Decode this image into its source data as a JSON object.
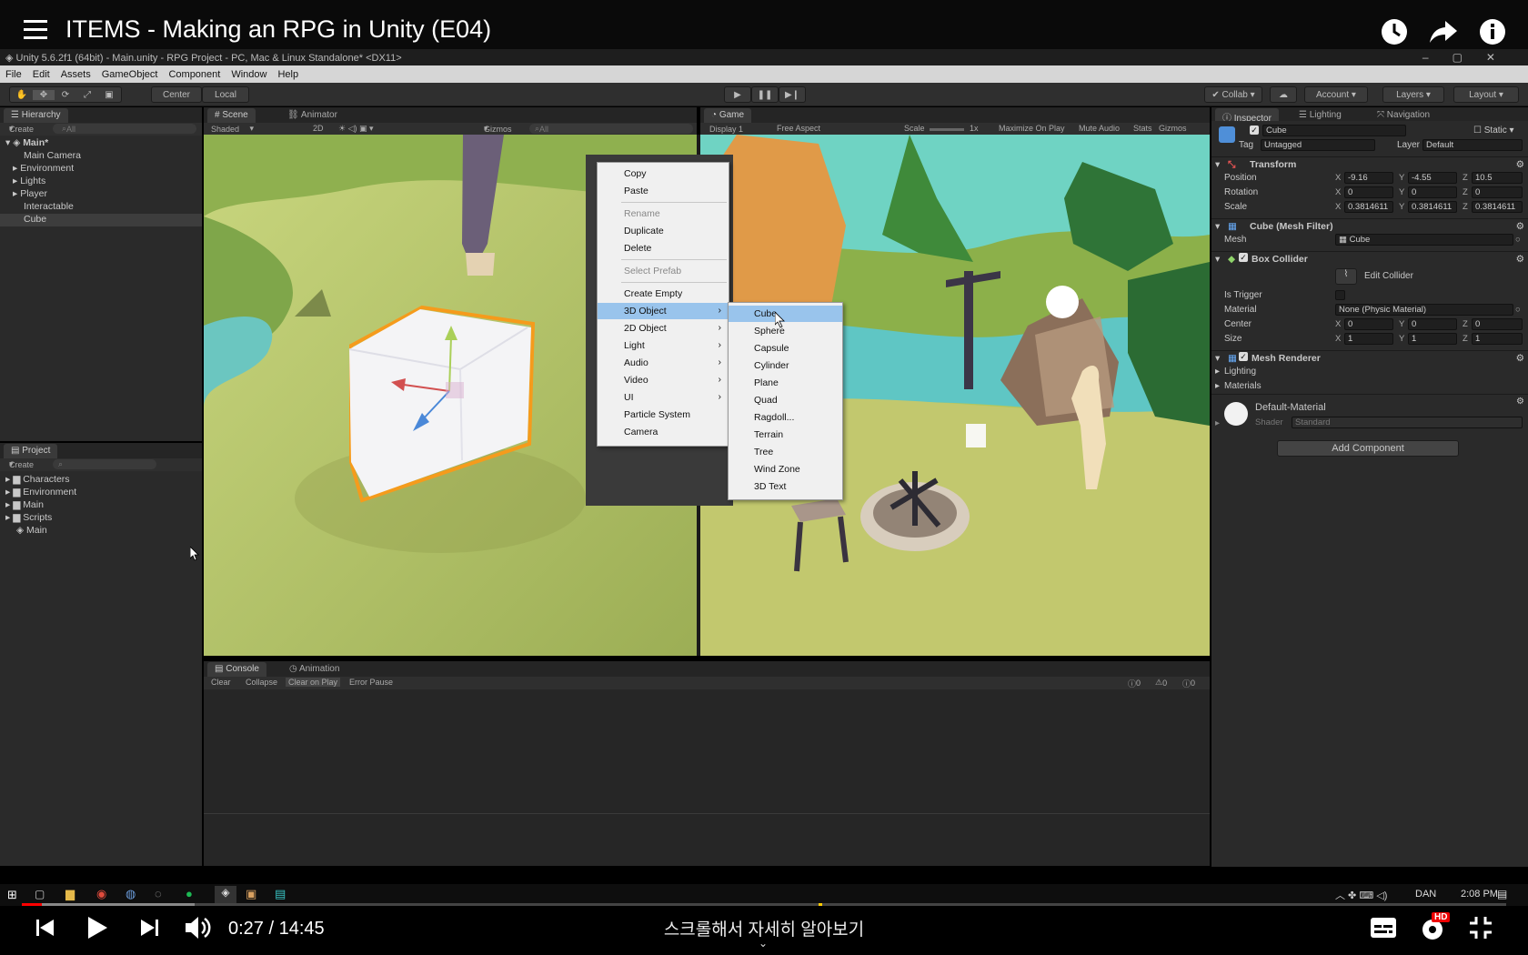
{
  "youtube": {
    "title": "ITEMS - Making an RPG in Unity (E04)",
    "time_current": "0:27",
    "time_separator": "/",
    "time_total": "14:45",
    "hint": "스크롤해서 자세히 알아보기",
    "progress_fraction": 0.0305,
    "hd_badge": "HD",
    "accent_color": "#ff0000"
  },
  "unity": {
    "window_title": "Unity 5.6.2f1 (64bit) - Main.unity - RPG Project - PC, Mac & Linux Standalone* <DX11>",
    "menu": [
      "File",
      "Edit",
      "Assets",
      "GameObject",
      "Component",
      "Window",
      "Help"
    ],
    "toolbar": {
      "center": "Center",
      "local": "Local",
      "collab": "Collab",
      "account": "Account",
      "layers": "Layers",
      "layout": "Layout"
    }
  },
  "hierarchy": {
    "tab": "Hierarchy",
    "create": "Create",
    "search": "All",
    "scene": "Main*",
    "items": [
      "Main Camera",
      "Environment",
      "Lights",
      "Player",
      "Interactable",
      "Cube"
    ]
  },
  "project": {
    "tab": "Project",
    "create": "Create",
    "items": [
      "Characters",
      "Environment",
      "Main",
      "Scripts",
      "Main"
    ]
  },
  "scene": {
    "tab": "Scene",
    "tab2": "Animator",
    "shaded": "Shaded",
    "mode2d": "2D",
    "gizmos": "Gizmos",
    "search": "All"
  },
  "game": {
    "tab": "Game",
    "display": "Display 1",
    "aspect": "Free Aspect",
    "scale_label": "Scale",
    "scale_value": "1x",
    "maximize": "Maximize On Play",
    "mute": "Mute Audio",
    "stats": "Stats",
    "gizmos": "Gizmos"
  },
  "context_menu": {
    "items": [
      {
        "label": "Copy"
      },
      {
        "label": "Paste"
      },
      {
        "label": "Rename",
        "disabled": true
      },
      {
        "label": "Duplicate"
      },
      {
        "label": "Delete"
      },
      {
        "label": "Select Prefab",
        "disabled": true
      },
      {
        "label": "Create Empty"
      },
      {
        "label": "3D Object",
        "submenu": true,
        "highlighted": true
      },
      {
        "label": "2D Object",
        "submenu": true
      },
      {
        "label": "Light",
        "submenu": true
      },
      {
        "label": "Audio",
        "submenu": true
      },
      {
        "label": "Video",
        "submenu": true
      },
      {
        "label": "UI",
        "submenu": true
      },
      {
        "label": "Particle System"
      },
      {
        "label": "Camera"
      }
    ],
    "submenu": [
      "Cube",
      "Sphere",
      "Capsule",
      "Cylinder",
      "Plane",
      "Quad",
      "Ragdoll...",
      "Terrain",
      "Tree",
      "Wind Zone",
      "3D Text"
    ],
    "submenu_highlight_color": "#99c4ec"
  },
  "inspector": {
    "tabs": [
      "Inspector",
      "Lighting",
      "Navigation"
    ],
    "object_name": "Cube",
    "static_label": "Static",
    "tag_label": "Tag",
    "tag_value": "Untagged",
    "layer_label": "Layer",
    "layer_value": "Default",
    "transform": {
      "title": "Transform",
      "position_label": "Position",
      "position": {
        "x": "-9.16",
        "y": "-4.55",
        "z": "10.5"
      },
      "rotation_label": "Rotation",
      "rotation": {
        "x": "0",
        "y": "0",
        "z": "0"
      },
      "scale_label": "Scale",
      "scale": {
        "x": "0.3814611",
        "y": "0.3814611",
        "z": "0.3814611"
      }
    },
    "mesh_filter": {
      "title": "Cube (Mesh Filter)",
      "mesh_label": "Mesh",
      "mesh_value": "Cube"
    },
    "box_collider": {
      "title": "Box Collider",
      "edit_collider": "Edit Collider",
      "is_trigger_label": "Is Trigger",
      "material_label": "Material",
      "material_value": "None (Physic Material)",
      "center_label": "Center",
      "center": {
        "x": "0",
        "y": "0",
        "z": "0"
      },
      "size_label": "Size",
      "size": {
        "x": "1",
        "y": "1",
        "z": "1"
      }
    },
    "mesh_renderer": {
      "title": "Mesh Renderer",
      "lighting": "Lighting",
      "materials": "Materials"
    },
    "material": {
      "name": "Default-Material",
      "shader_label": "Shader",
      "shader_value": "Standard"
    },
    "add_component": "Add Component"
  },
  "console": {
    "tab": "Console",
    "tab2": "Animation",
    "buttons": [
      "Clear",
      "Collapse",
      "Clear on Play",
      "Error Pause"
    ],
    "counts": [
      "0",
      "0",
      "0"
    ]
  },
  "taskbar": {
    "lang": "DAN",
    "time": "2:08 PM"
  }
}
